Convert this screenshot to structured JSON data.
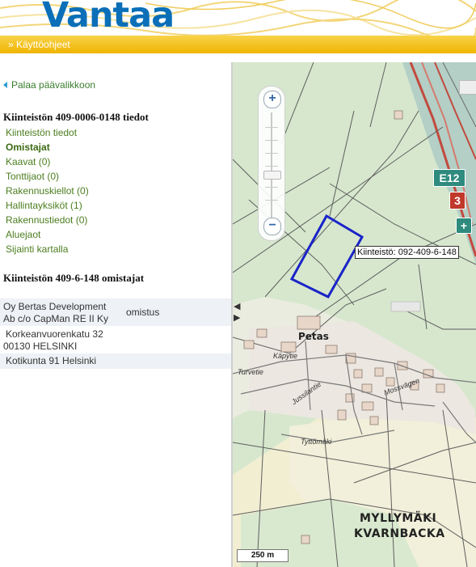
{
  "header": {
    "logo": "Vantaa",
    "help_link": "» Käyttöohjeet"
  },
  "panel": {
    "back_link": "Palaa päävalikkoon",
    "property_title": "Kiinteistön 409-0006-0148 tiedot",
    "menu": [
      {
        "label": "Kiinteistön tiedot",
        "active": false
      },
      {
        "label": "Omistajat",
        "active": true
      },
      {
        "label": "Kaavat (0)",
        "active": false
      },
      {
        "label": "Tonttijaot (0)",
        "active": false
      },
      {
        "label": "Rakennuskiellot (0)",
        "active": false
      },
      {
        "label": "Hallintayksiköt (1)",
        "active": false
      },
      {
        "label": "Rakennustiedot (0)",
        "active": false
      },
      {
        "label": "Aluejaot",
        "active": false
      },
      {
        "label": "Sijainti kartalla",
        "active": false
      }
    ],
    "owners_title": "Kiinteistön 409-6-148 omistajat",
    "owners": {
      "name_line1": "Oy Bertas Development",
      "name_line2": "Ab c/o CapMan RE II Ky",
      "role": "omistus",
      "address_line1": "Korkeanvuorenkatu 32",
      "address_line2": "00130 HELSINKI",
      "municipality": "Kotikunta 91 Helsinki"
    }
  },
  "map": {
    "parcel_label": "Kiinteistö: 092-409-6-148",
    "scale": "250 m",
    "places": {
      "petas": "Petas",
      "myllymaki": "MYLLYMÄKI",
      "kvarnbacka": "KVARNBACKA"
    },
    "streets": {
      "kaupintie": "Käpytie",
      "turvetie": "Turvetie",
      "tyttomaki": "Tyttömäki",
      "mossvagen": "Mossvägen",
      "jussilantie": "Jussilantie"
    },
    "road_signs": {
      "e12": "E12",
      "three": "3"
    },
    "icons": [
      "zoom-in-icon",
      "zoom-out-icon",
      "collapse-left-icon",
      "expand-right-icon"
    ],
    "colors": {
      "parcel_outline": "#1a23c8",
      "brand_blue": "#0a6fb8",
      "header_yellow": "#efb400",
      "link_green": "#4b7d1e",
      "map_green": "#d6e7cd"
    }
  }
}
